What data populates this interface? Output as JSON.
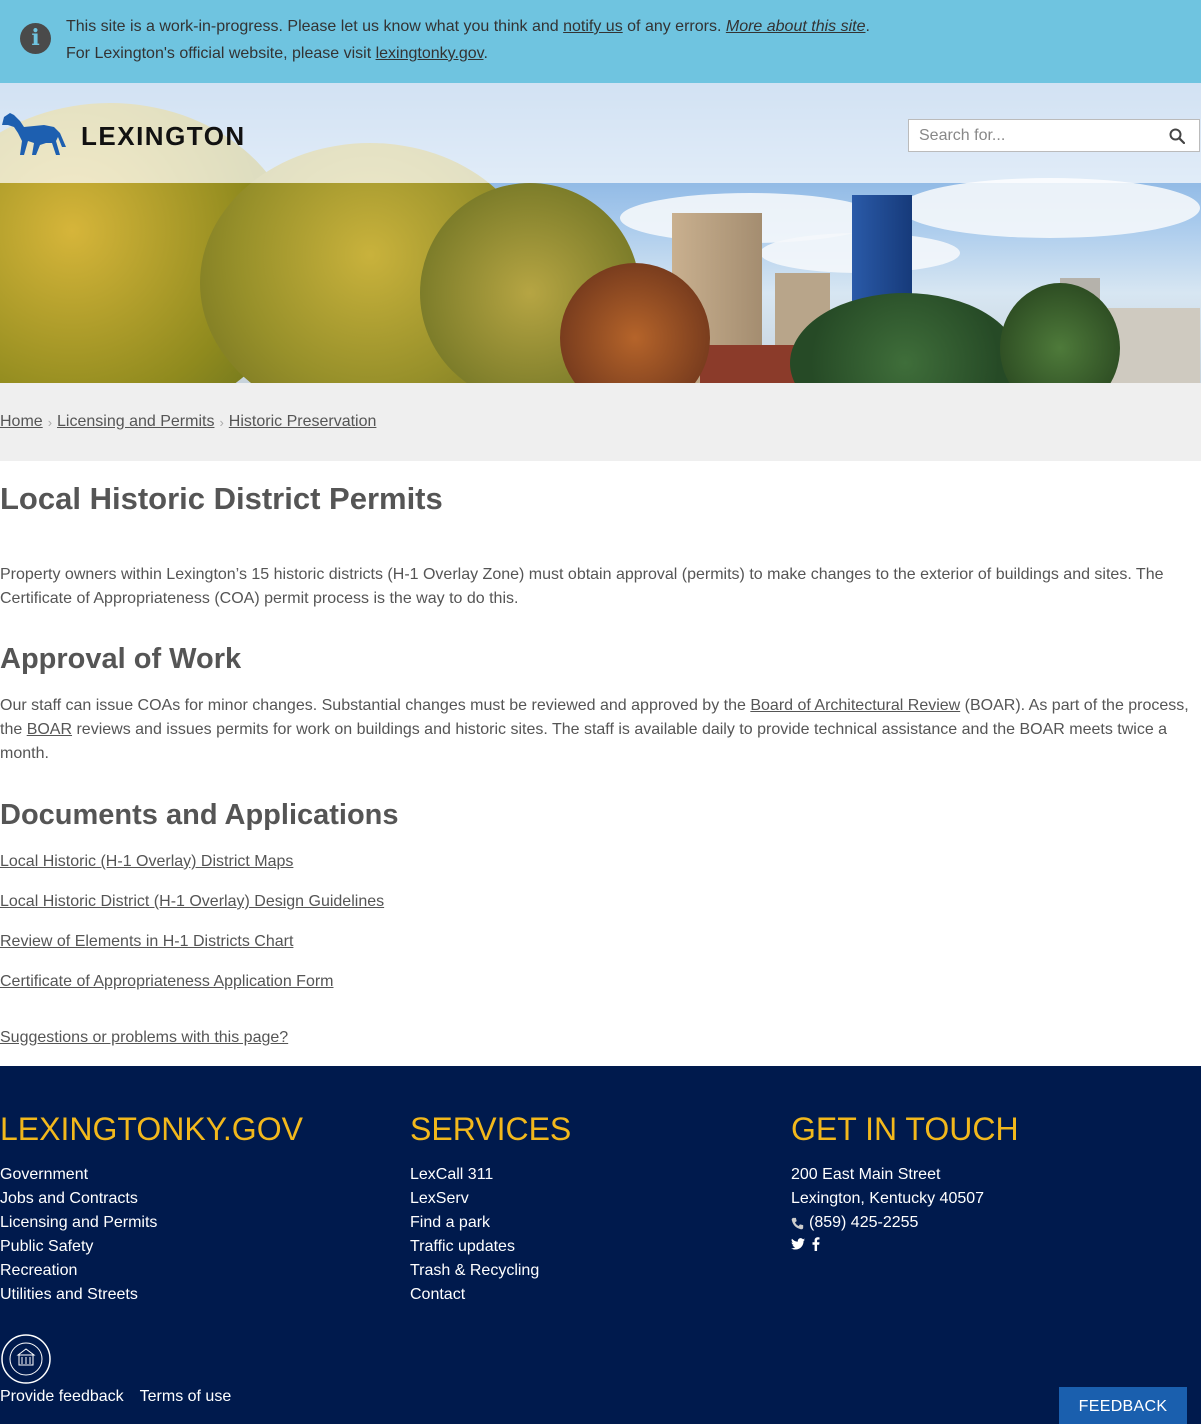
{
  "notice": {
    "line1_before": "This site is a work-in-progress. Please let us know what you think and ",
    "line1_link": "notify us",
    "line1_middle": " of any errors. ",
    "line1_italic_link": "More about this site",
    "line1_end": ".",
    "line2_before": "For Lexington's official website, please visit ",
    "line2_link": "lexingtonky.gov",
    "line2_end": "."
  },
  "header": {
    "logo_text": "LEXINGTON",
    "search_placeholder": "Search for..."
  },
  "breadcrumb": [
    "Home",
    "Licensing and Permits",
    "Historic Preservation"
  ],
  "main": {
    "title": "Local Historic District Permits",
    "intro": "Property owners within Lexington’s 15 historic districts (H-1 Overlay Zone) must obtain approval (permits) to make changes to the exterior of buildings and sites. The Certificate of Appropriateness (COA) permit process is the way to do this.",
    "approval_heading": "Approval of Work",
    "approval_p_before": "Our staff can issue COAs for minor changes. Substantial changes must be reviewed and approved by the ",
    "approval_p_link1": "Board of Architectural Review",
    "approval_p_mid": " (BOAR). As part of the process, the ",
    "approval_p_link2": "BOAR",
    "approval_p_after": " reviews and issues permits for work on buildings and historic sites. The staff is available daily to provide technical assistance and the BOAR meets twice a month.",
    "docs_heading": "Documents and Applications",
    "docs": [
      "Local Historic (H-1 Overlay) District Maps",
      "Local Historic District (H-1 Overlay) Design Guidelines",
      "Review of Elements in H-1 Districts Chart",
      "Certificate of Appropriateness Application Form"
    ],
    "suggestions": "Suggestions or problems with this page?"
  },
  "footer": {
    "col1_title": "LEXINGTONKY.GOV",
    "col1_links": [
      "Government",
      "Jobs and Contracts",
      "Licensing and Permits",
      "Public Safety",
      "Recreation",
      "Utilities and Streets"
    ],
    "col2_title": "SERVICES",
    "col2_links": [
      "LexCall 311",
      "LexServ",
      "Find a park",
      "Traffic updates",
      "Trash & Recycling",
      "Contact"
    ],
    "col3_title": "GET IN TOUCH",
    "address1": "200 East Main Street",
    "address2": "Lexington, Kentucky 40507",
    "phone": "(859) 425-2255",
    "bottom_links": [
      "Provide feedback",
      "Terms of use"
    ],
    "feedback_button": "FEEDBACK"
  },
  "colors": {
    "notice_bg": "#6fc4e0",
    "footer_bg": "#001a4d",
    "footer_heading": "#f2b81c",
    "feedback_button": "#1a5fae",
    "logo_horse": "#1d5fb0"
  },
  "icons": [
    "info-icon",
    "horse-logo-icon",
    "search-icon",
    "phone-icon",
    "twitter-icon",
    "facebook-icon",
    "city-seal-icon"
  ]
}
